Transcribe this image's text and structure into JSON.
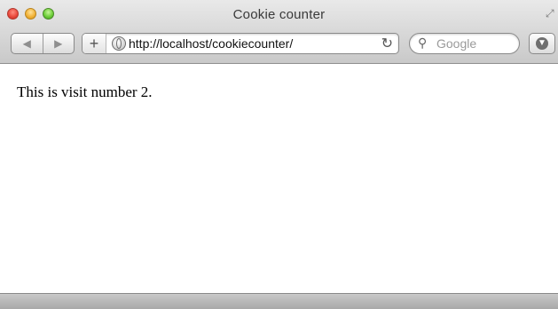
{
  "window": {
    "title": "Cookie counter"
  },
  "toolbar": {
    "back_icon": "back-arrow-icon",
    "forward_icon": "forward-arrow-icon",
    "add_icon": "plus-icon",
    "url": "http://localhost/cookiecounter/",
    "reload_icon": "reload-icon",
    "search_placeholder": "Google",
    "download_icon": "download-icon"
  },
  "content": {
    "text": "This is visit number 2."
  }
}
